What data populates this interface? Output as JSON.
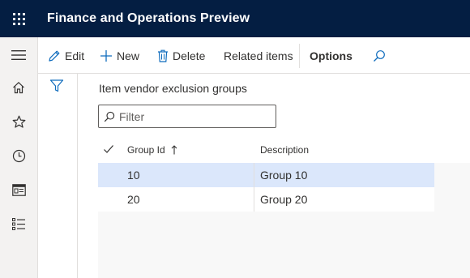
{
  "app": {
    "title": "Finance and Operations Preview"
  },
  "nav": {
    "items": [
      {
        "icon": "home-icon"
      },
      {
        "icon": "star-icon"
      },
      {
        "icon": "clock-icon"
      },
      {
        "icon": "workspace-icon"
      },
      {
        "icon": "list-icon"
      }
    ]
  },
  "actionpane": {
    "edit_label": "Edit",
    "new_label": "New",
    "delete_label": "Delete",
    "related_label": "Related items",
    "options_label": "Options"
  },
  "page": {
    "section_title": "Item vendor exclusion groups",
    "filter_placeholder": "Filter"
  },
  "grid": {
    "columns": [
      "Group Id",
      "Description"
    ],
    "rows": [
      {
        "group_id": "10",
        "description": "Group 10",
        "selected": true
      },
      {
        "group_id": "20",
        "description": "Group 20",
        "selected": false
      }
    ]
  },
  "colors": {
    "topbar": "#041e42",
    "accent": "#0f6cbd",
    "selected_row": "#dbe7fb"
  }
}
